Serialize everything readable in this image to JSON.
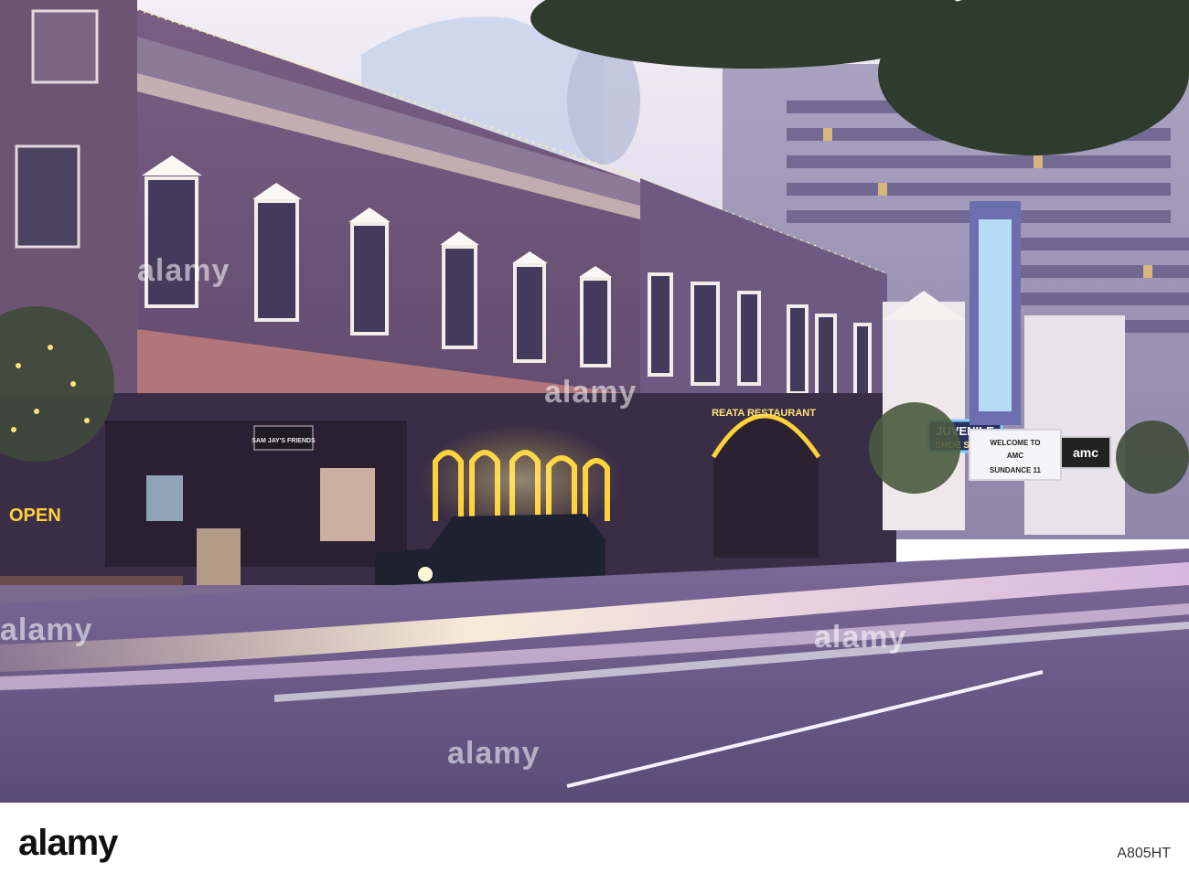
{
  "watermark": {
    "text": "alamy"
  },
  "signs": {
    "juvenile": "JUVENILE",
    "shoe_store": "SHOE STORE",
    "marquee_line1": "WELCOME TO",
    "marquee_line2": "AMC",
    "marquee_line3": "SUNDANCE 11",
    "amc": "amc",
    "open": "OPEN",
    "reata": "REATA RESTAURANT",
    "fine_art": "SAM JAY'S FRIENDS"
  },
  "footer": {
    "brand": "alamy",
    "image_id": "A805HT"
  },
  "colors": {
    "sky": "#e8e4ef",
    "building_main": "#6a5577",
    "awning": "#b0767a",
    "road": "#6b5a87",
    "neon_yellow": "#ffd23a",
    "neon_blue": "#7fd0ff"
  }
}
